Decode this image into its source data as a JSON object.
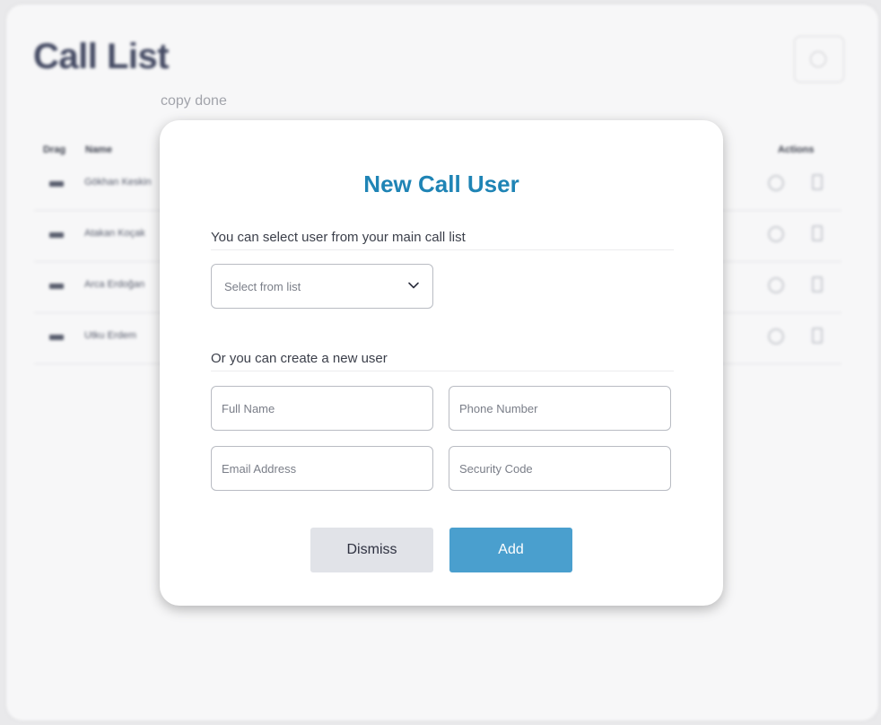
{
  "background": {
    "title": "Call List",
    "columns": {
      "drag": "Drag",
      "name": "Name",
      "actions": "Actions"
    },
    "rows": [
      {
        "name": "Gökhan Keskin"
      },
      {
        "name": "Atakan Koçak"
      },
      {
        "name": "Arca Erdoğan"
      },
      {
        "name": "Utku Erdem"
      }
    ],
    "toast": "copy done"
  },
  "modal": {
    "title": "New Call User",
    "select_section_label": "You can select user from your main call list",
    "select_placeholder": "Select from list",
    "create_section_label": "Or you can create a new user",
    "fields": {
      "full_name": {
        "placeholder": "Full Name",
        "value": ""
      },
      "phone_number": {
        "placeholder": "Phone Number",
        "value": ""
      },
      "email_address": {
        "placeholder": "Email Address",
        "value": ""
      },
      "security_code": {
        "placeholder": "Security Code",
        "value": ""
      }
    },
    "dismiss_label": "Dismiss",
    "add_label": "Add"
  },
  "colors": {
    "title_accent": "#1f84b5",
    "add_button": "#4a9fce",
    "dismiss_button": "#e1e3e8"
  },
  "icons": {
    "select_chevron": "chevron-down-icon",
    "header_add": "add-circle-icon",
    "row_edit": "edit-icon",
    "row_delete": "trash-icon",
    "row_drag": "drag-handle-icon"
  }
}
